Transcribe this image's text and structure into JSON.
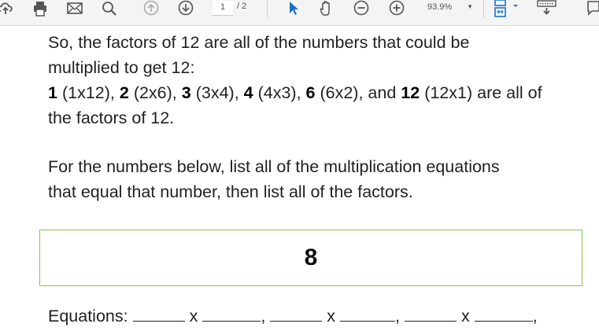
{
  "toolbar": {
    "page_current": "1",
    "page_total": "/ 2",
    "zoom": "93.9%",
    "icons": [
      "upload-icon",
      "print-icon",
      "email-icon",
      "search-icon",
      "prev-page-icon",
      "next-page-icon",
      "select-pointer-icon",
      "hand-tool-icon",
      "zoom-out-icon",
      "zoom-in-icon",
      "zoom-dropdown-icon",
      "page-display-icon",
      "keyboard-icon",
      "comment-icon"
    ],
    "accent_color": "#1a73c8"
  },
  "document": {
    "paragraph1": {
      "line1": "So, the factors of 12 are all of the numbers that could be",
      "line2": "multiplied to get 12:",
      "factors": [
        {
          "factor": "1",
          "pair": "(1x12)"
        },
        {
          "factor": "2",
          "pair": "(2x6)"
        },
        {
          "factor": "3",
          "pair": "(3x4)"
        },
        {
          "factor": "4",
          "pair": "(4x3)"
        },
        {
          "factor": "6",
          "pair": "(6x2)"
        },
        {
          "factor": "12",
          "pair": "(12x1)"
        }
      ],
      "and_word": "and",
      "tail1": "are all of",
      "tail2": "the factors of 12."
    },
    "paragraph2": {
      "line1": "For the numbers below, list all of the multiplication equations",
      "line2": "that equal that number, then list all of the factors."
    },
    "number_box": "8",
    "box_border_color": "#8cc63f",
    "equations_label": "Equations:",
    "times": "x"
  }
}
